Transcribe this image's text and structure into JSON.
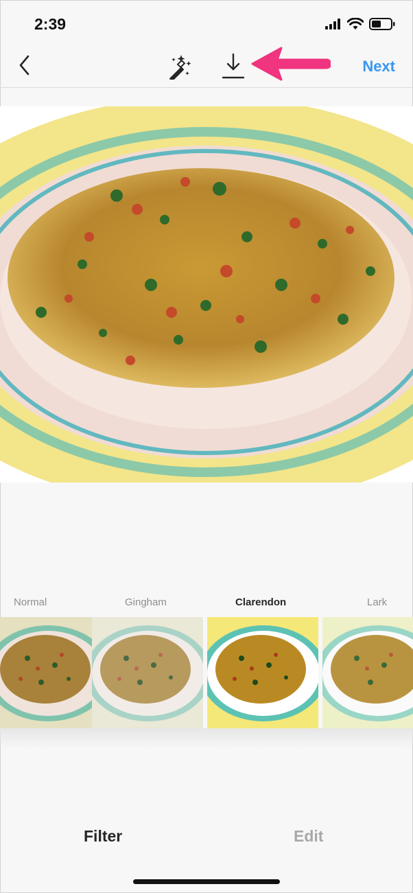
{
  "status_bar": {
    "time": "2:39",
    "icons": [
      "signal-icon",
      "wifi-icon",
      "battery-icon"
    ]
  },
  "nav": {
    "back_icon": "chevron-left-icon",
    "magic_icon": "magic-wand-icon",
    "download_icon": "download-icon",
    "annotation_icon": "pink-arrow-icon",
    "next_label": "Next"
  },
  "filters": [
    {
      "label": "Normal",
      "active": false
    },
    {
      "label": "Gingham",
      "active": false
    },
    {
      "label": "Clarendon",
      "active": true
    },
    {
      "label": "Lark",
      "active": false
    }
  ],
  "tabs": {
    "filter": "Filter",
    "edit": "Edit"
  },
  "colors": {
    "accent": "#3897f0",
    "annotation": "#f0347f",
    "active_text": "#262626",
    "inactive_text": "#a8a8a8"
  }
}
